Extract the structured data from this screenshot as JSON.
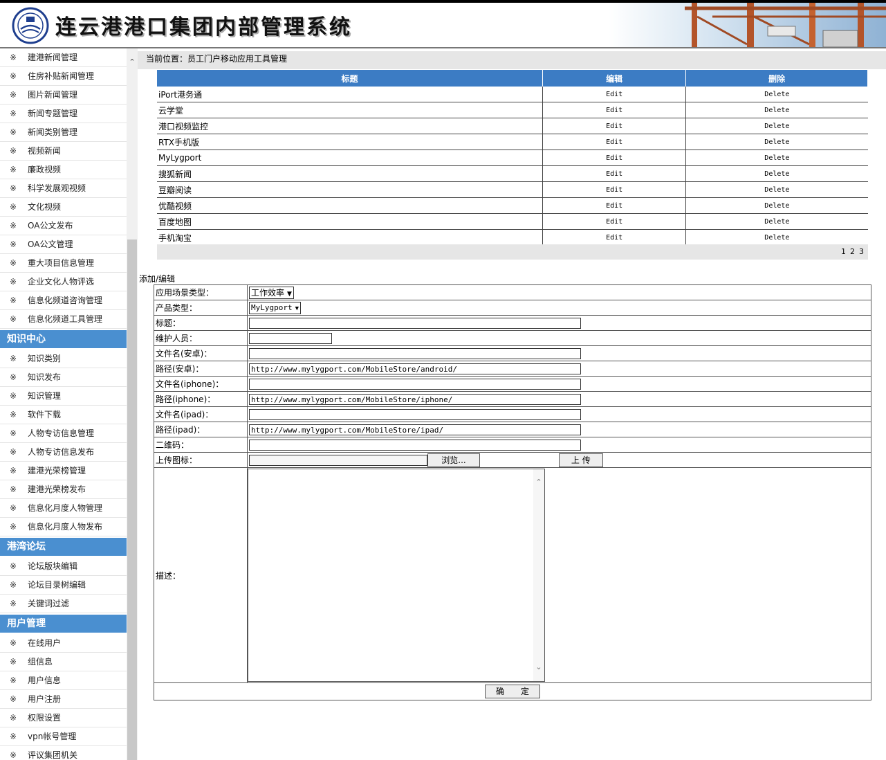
{
  "header": {
    "title": "连云港港口集团内部管理系统"
  },
  "sidebar": {
    "group1_items": [
      "建港新闻管理",
      "住房补贴新闻管理",
      "图片新闻管理",
      "新闻专题管理",
      "新闻类别管理",
      "视频新闻",
      "廉政视频",
      "科学发展观视频",
      "文化视频",
      "OA公文发布",
      "OA公文管理",
      "重大项目信息管理",
      "企业文化人物评选",
      "信息化频道咨询管理",
      "信息化频道工具管理"
    ],
    "section_knowledge": "知识中心",
    "knowledge_items": [
      "知识类别",
      "知识发布",
      "知识管理",
      "软件下载",
      "人物专访信息管理",
      "人物专访信息发布",
      "建港光荣榜管理",
      "建港光荣榜发布",
      "信息化月度人物管理",
      "信息化月度人物发布"
    ],
    "section_forum": "港湾论坛",
    "forum_items": [
      "论坛版块编辑",
      "论坛目录树编辑",
      "关键词过滤"
    ],
    "section_users": "用户管理",
    "users_items": [
      "在线用户",
      "组信息",
      "用户信息",
      "用户注册",
      "权限设置",
      "vpn帐号管理",
      "评议集团机关"
    ],
    "mark": "※"
  },
  "breadcrumb": "当前位置：员工门户移动应用工具管理",
  "grid": {
    "headers": [
      "标题",
      "编辑",
      "删除"
    ],
    "rows": [
      {
        "title": "iPort港务通",
        "edit": "Edit",
        "del": "Delete"
      },
      {
        "title": "云学堂",
        "edit": "Edit",
        "del": "Delete"
      },
      {
        "title": "港口视频监控",
        "edit": "Edit",
        "del": "Delete"
      },
      {
        "title": "RTX手机版",
        "edit": "Edit",
        "del": "Delete"
      },
      {
        "title": "MyLygport",
        "edit": "Edit",
        "del": "Delete"
      },
      {
        "title": "搜狐新闻",
        "edit": "Edit",
        "del": "Delete"
      },
      {
        "title": "豆瓣阅读",
        "edit": "Edit",
        "del": "Delete"
      },
      {
        "title": "优酷视频",
        "edit": "Edit",
        "del": "Delete"
      },
      {
        "title": "百度地图",
        "edit": "Edit",
        "del": "Delete"
      },
      {
        "title": "手机淘宝",
        "edit": "Edit",
        "del": "Delete"
      }
    ],
    "pages": [
      "1",
      "2",
      "3"
    ]
  },
  "form": {
    "title": "添加/编辑",
    "scene_label": "应用场景类型：",
    "scene_value": "工作效率",
    "product_label": "产品类型：",
    "product_value": "MyLygport",
    "title_label": "标题：",
    "maintainer_label": "维护人员：",
    "file_android_label": "文件名(安卓)：",
    "path_android_label": "路径(安卓)：",
    "path_android_value": "http://www.mylygport.com/MobileStore/android/",
    "file_iphone_label": "文件名(iphone)：",
    "path_iphone_label": "路径(iphone)：",
    "path_iphone_value": "http://www.mylygport.com/MobileStore/iphone/",
    "file_ipad_label": "文件名(ipad)：",
    "path_ipad_label": "路径(ipad)：",
    "path_ipad_value": "http://www.mylygport.com/MobileStore/ipad/",
    "qrcode_label": "二维码：",
    "upload_label": "上传图标：",
    "browse_label": "浏览...",
    "upload_button": "上 传",
    "desc_label": "描述：",
    "submit_button": "确　　定"
  }
}
